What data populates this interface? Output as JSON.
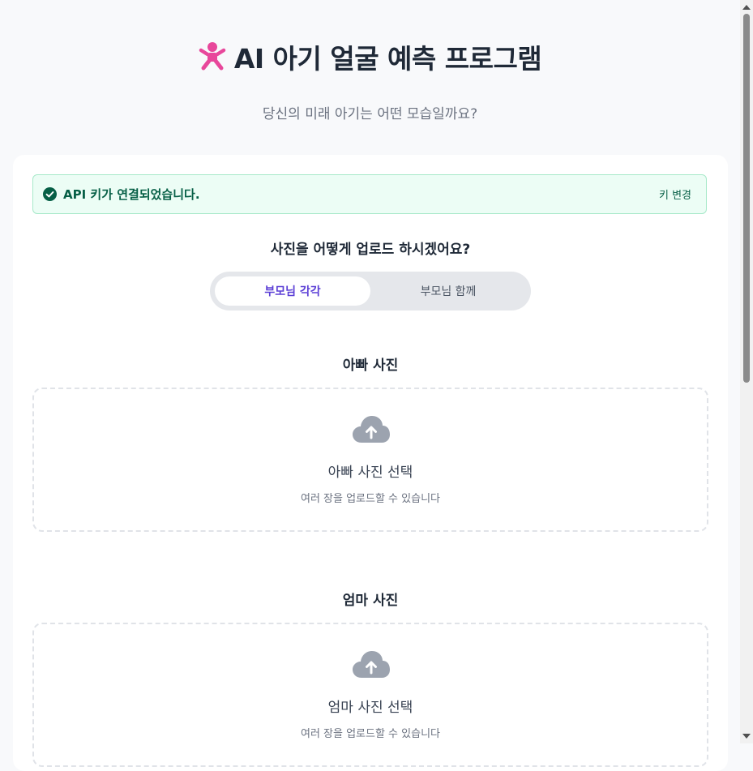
{
  "header": {
    "title": "AI 아기 얼굴 예측 프로그램",
    "subtitle": "당신의 미래 아기는 어떤 모습일까요?",
    "title_icon": "baby-icon"
  },
  "alert": {
    "text": "API 키가 연결되었습니다.",
    "change_key_label": "키 변경",
    "icon": "check-circle-icon"
  },
  "upload": {
    "question": "사진을 어떻게 업로드 하시겠어요?",
    "modes": [
      {
        "label": "부모님 각각",
        "selected": true
      },
      {
        "label": "부모님 함께",
        "selected": false
      }
    ],
    "sections": [
      {
        "title": "아빠 사진",
        "select_label": "아빠 사진 선택",
        "hint": "여러 장을 업로드할 수 있습니다",
        "icon": "cloud-upload-icon"
      },
      {
        "title": "엄마 사진",
        "select_label": "엄마 사진 선택",
        "hint": "여러 장을 업로드할 수 있습니다",
        "icon": "cloud-upload-icon"
      }
    ]
  },
  "colors": {
    "accent": "#5b3fd6",
    "baby_icon": "#e8479b",
    "success_bg": "#ecfdf5",
    "success_text": "#065f46",
    "icon_gray": "#9ca3af"
  }
}
